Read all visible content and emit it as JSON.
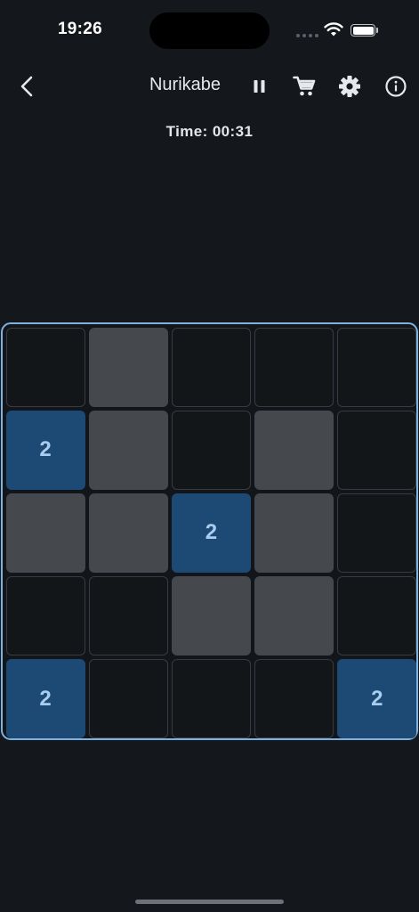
{
  "status_bar": {
    "time": "19:26"
  },
  "app_bar": {
    "title": "Nurikabe",
    "icons": [
      "back-chevron-icon",
      "pause-icon",
      "cart-icon",
      "gear-icon",
      "info-icon"
    ]
  },
  "timer": {
    "text": "Time: 00:31"
  },
  "board": {
    "size": 5,
    "cells": [
      [
        {
          "state": "empty",
          "clue": ""
        },
        {
          "state": "shaded",
          "clue": ""
        },
        {
          "state": "empty",
          "clue": ""
        },
        {
          "state": "empty",
          "clue": ""
        },
        {
          "state": "empty",
          "clue": ""
        }
      ],
      [
        {
          "state": "clue",
          "clue": "2"
        },
        {
          "state": "shaded",
          "clue": ""
        },
        {
          "state": "empty",
          "clue": ""
        },
        {
          "state": "shaded",
          "clue": ""
        },
        {
          "state": "empty",
          "clue": ""
        }
      ],
      [
        {
          "state": "shaded",
          "clue": ""
        },
        {
          "state": "shaded",
          "clue": ""
        },
        {
          "state": "clue",
          "clue": "2"
        },
        {
          "state": "shaded",
          "clue": ""
        },
        {
          "state": "empty",
          "clue": ""
        }
      ],
      [
        {
          "state": "empty",
          "clue": ""
        },
        {
          "state": "empty",
          "clue": ""
        },
        {
          "state": "shaded",
          "clue": ""
        },
        {
          "state": "shaded",
          "clue": ""
        },
        {
          "state": "empty",
          "clue": ""
        }
      ],
      [
        {
          "state": "clue",
          "clue": "2"
        },
        {
          "state": "empty",
          "clue": ""
        },
        {
          "state": "empty",
          "clue": ""
        },
        {
          "state": "empty",
          "clue": ""
        },
        {
          "state": "clue",
          "clue": "2"
        }
      ]
    ]
  },
  "colors": {
    "background": "#14171b",
    "board_border": "#7fb1de",
    "shaded_cell": "#45484d",
    "clue_cell": "#1d4a75",
    "clue_text": "#a9cdef"
  }
}
